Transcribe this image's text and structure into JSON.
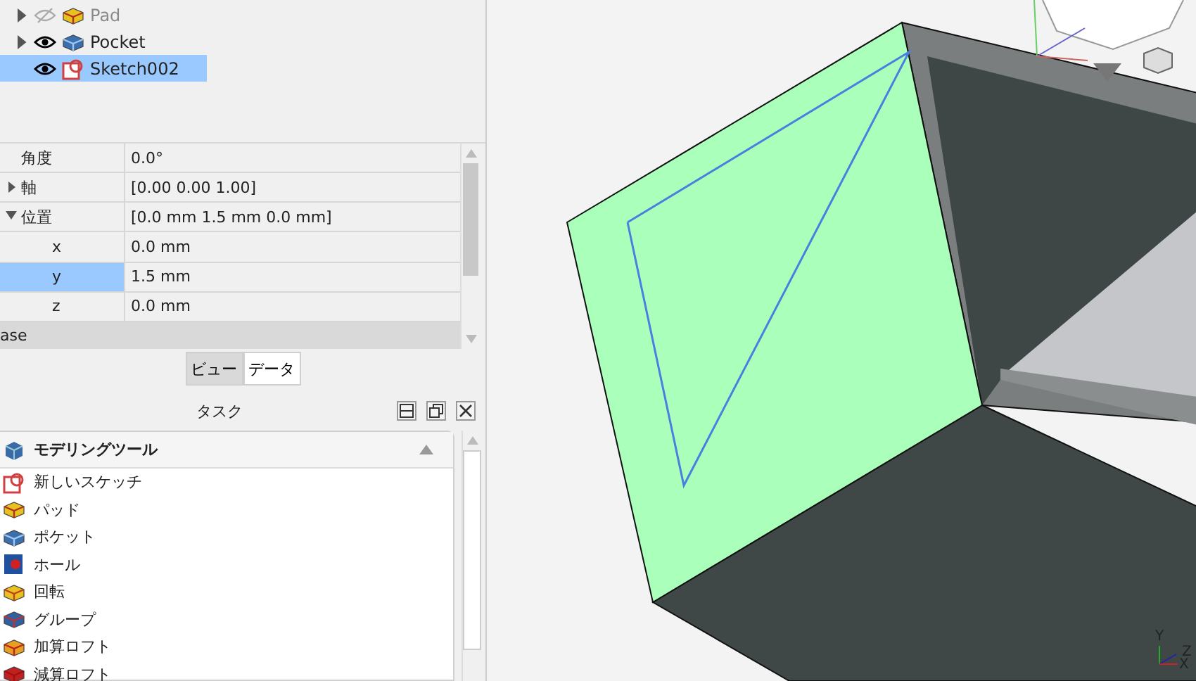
{
  "tree": {
    "items": [
      {
        "label": "Pad",
        "expanded": false,
        "visible": false,
        "selected": false,
        "kind": "pad"
      },
      {
        "label": "Pocket",
        "expanded": false,
        "visible": true,
        "selected": false,
        "kind": "pocket"
      },
      {
        "label": "Sketch002",
        "visible": true,
        "selected": true,
        "kind": "sketch"
      }
    ]
  },
  "properties": {
    "rows": [
      {
        "name": "角度",
        "value": "0.0°",
        "sub": false,
        "selected": false
      },
      {
        "name": "軸",
        "value": "[0.00 0.00 1.00]",
        "expanded": false,
        "sub": false,
        "selected": false
      },
      {
        "name": "位置",
        "value": "[0.0 mm 1.5 mm 0.0 mm]",
        "expanded": true,
        "sub": false,
        "selected": false
      },
      {
        "name": "x",
        "value": "0.0 mm",
        "sub": true,
        "selected": false
      },
      {
        "name": "y",
        "value": "1.5 mm",
        "sub": true,
        "selected": true
      },
      {
        "name": "z",
        "value": "0.0 mm",
        "sub": true,
        "selected": false
      }
    ],
    "group": "ase"
  },
  "tabs": [
    {
      "label": "ビュー",
      "selected": false
    },
    {
      "label": "データ",
      "selected": true
    }
  ],
  "task_panel": {
    "title": "タスク",
    "section": {
      "title": "モデリングツール",
      "expanded": true,
      "items": [
        {
          "label": "新しいスケッチ",
          "kind": "sketch"
        },
        {
          "label": "パッド",
          "kind": "pad"
        },
        {
          "label": "ポケット",
          "kind": "pocket"
        },
        {
          "label": "ホール",
          "kind": "hole"
        },
        {
          "label": "回転",
          "kind": "revolve"
        },
        {
          "label": "グループ",
          "kind": "groove"
        },
        {
          "label": "加算ロフト",
          "kind": "loft-add"
        },
        {
          "label": "減算ロフト",
          "kind": "loft-sub"
        }
      ]
    }
  },
  "view3d": {
    "axis_labels": [
      "Y",
      "Z",
      "X"
    ]
  }
}
